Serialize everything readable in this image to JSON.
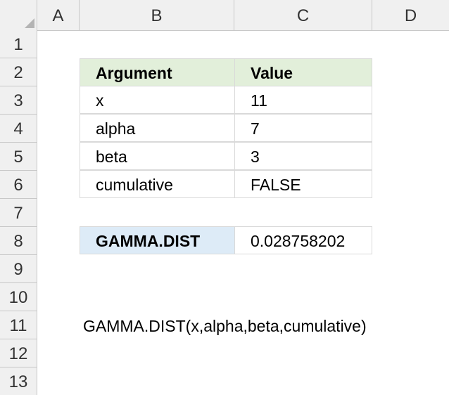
{
  "columns": [
    "A",
    "B",
    "C",
    "D"
  ],
  "rows": [
    "1",
    "2",
    "3",
    "4",
    "5",
    "6",
    "7",
    "8",
    "9",
    "10",
    "11",
    "12",
    "13"
  ],
  "table": {
    "header": {
      "argument": "Argument",
      "value": "Value"
    },
    "rows": [
      {
        "argument": "x",
        "value": "11"
      },
      {
        "argument": "alpha",
        "value": "7"
      },
      {
        "argument": "beta",
        "value": "3"
      },
      {
        "argument": "cumulative",
        "value": "FALSE"
      }
    ]
  },
  "result": {
    "label": "GAMMA.DIST",
    "value": "0.028758202"
  },
  "syntax": "GAMMA.DIST(x,alpha,beta,cumulative)",
  "colors": {
    "header_fill": "#e2efda",
    "result_fill": "#ddebf7",
    "grid": "#d9d9d9",
    "headers_bg": "#f0f0f0"
  }
}
